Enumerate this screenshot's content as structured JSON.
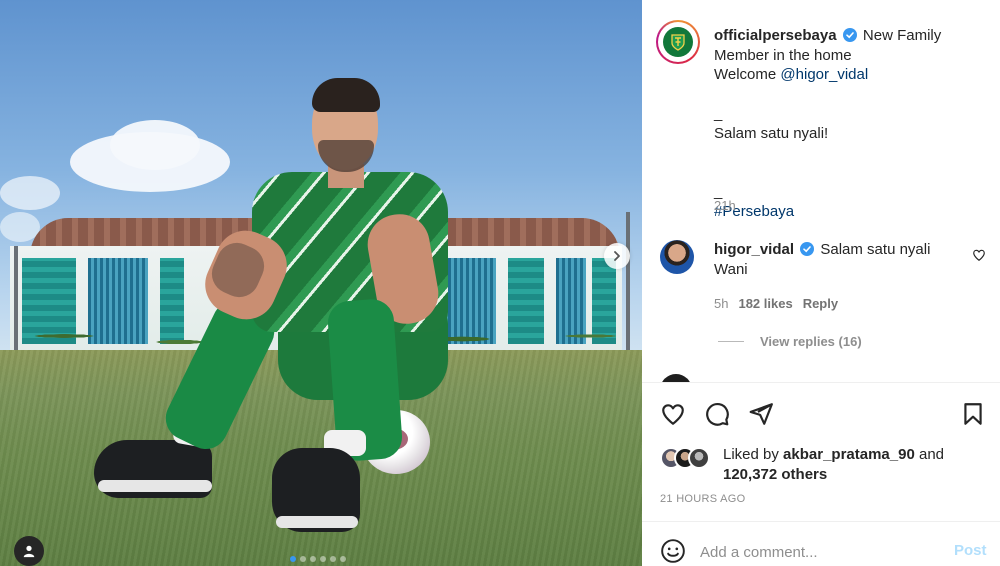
{
  "post": {
    "account": "officialpersebaya",
    "caption_lines": [
      "New Family",
      "Member in the home ",
      "Welcome "
    ],
    "caption_mention": "@higor_vidal",
    "separator_1": "_",
    "salam": "Salam satu nyali!",
    "emoji_row_1": "",
    "separator_2": "_",
    "hashtag": "#Persebaya",
    "posted_ago": "21h"
  },
  "comment": {
    "username": "higor_vidal",
    "text": "Salam satu nyali Wani",
    "emojis": "",
    "age": "5h",
    "likes": "182 likes",
    "reply_label": "Reply",
    "view_replies": "View replies (16)"
  },
  "likes": {
    "prefix": "Liked by",
    "user": "akbar_pratama_90",
    "connector": "and",
    "count": "120,372 others"
  },
  "timestamp": "21 HOURS AGO",
  "composer": {
    "placeholder": "Add a comment...",
    "post_label": "Post"
  },
  "media": {
    "slide_count": 6,
    "active_slide": 1
  },
  "colors": {
    "verified": "#3897f0",
    "link": "#00376b",
    "post_disabled": "#b2dffc",
    "club_green": "#11783a"
  },
  "icons": [
    "heart-icon",
    "comment-icon",
    "share-icon",
    "bookmark-icon",
    "emoji-icon",
    "chevron-right-icon",
    "user-tag-icon",
    "verified-icon"
  ]
}
